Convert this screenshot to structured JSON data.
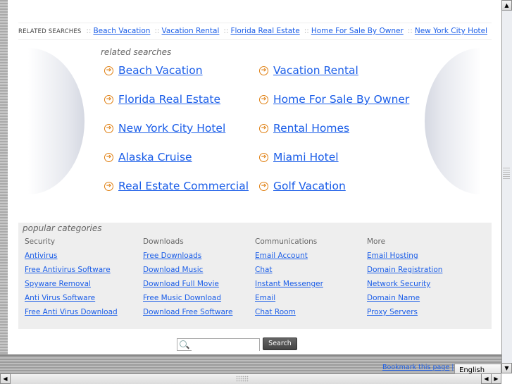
{
  "topbar": {
    "label": "RELATED SEARCHES",
    "links": [
      "Beach Vacation",
      "Vacation Rental",
      "Florida Real Estate",
      "Home For Sale By Owner",
      "New York City Hotel"
    ],
    "separator": "::"
  },
  "related": {
    "heading": "related searches",
    "links": [
      "Beach Vacation",
      "Vacation Rental",
      "Florida Real Estate",
      "Home For Sale By Owner",
      "New York City Hotel",
      "Rental Homes",
      "Alaska Cruise",
      "Miami Hotel",
      "Real Estate Commercial",
      "Golf Vacation"
    ],
    "icon": "arrow-circle-icon"
  },
  "popular": {
    "title": "popular categories",
    "columns": [
      {
        "heading": "Security",
        "links": [
          "Antivirus",
          "Free Antivirus Software",
          "Spyware Removal",
          "Anti Virus Software",
          "Free Anti Virus Download"
        ]
      },
      {
        "heading": "Downloads",
        "links": [
          "Free Downloads",
          "Download Music",
          "Download Full Movie",
          "Free Music Download",
          "Download Free Software"
        ]
      },
      {
        "heading": "Communications",
        "links": [
          "Email Account",
          "Chat",
          "Instant Messenger",
          "Email",
          "Chat Room"
        ]
      },
      {
        "heading": "More",
        "links": [
          "Email Hosting",
          "Domain Registration",
          "Network Security",
          "Domain Name",
          "Proxy Servers"
        ]
      }
    ]
  },
  "search": {
    "value": "",
    "button": "Search"
  },
  "footer": {
    "bookmark": "Bookmark this page",
    "pipe": "|",
    "language": "English"
  },
  "colors": {
    "link": "#1a5de8",
    "accent": "#e07f10",
    "panel": "#eeeeee"
  }
}
